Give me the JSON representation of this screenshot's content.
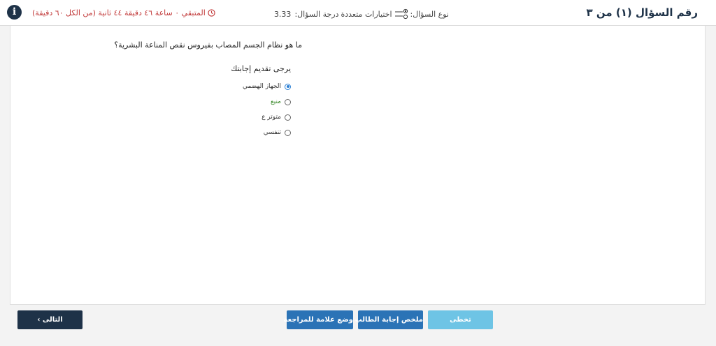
{
  "header": {
    "question_number": "رقم السؤال (١) من ٣",
    "question_type_label": "نوع السؤال:",
    "question_type_value": "اختيارات متعددة",
    "score_label": "درجة السؤال:",
    "score_value": "3.33",
    "timer_text": "المتبقي ٠ ساعة ٤٦ دقيقة ٤٤ ثانية (من الكل ٦٠ دقيقة)",
    "type_icon": "radio-list-icon",
    "timer_icon": "clock-icon",
    "info_icon": "info-icon",
    "info_glyph": "i"
  },
  "question": {
    "text": "ما هو نظام الجسم المصاب بفيروس نقص المناعة البشرية؟",
    "instruction": "يرجى تقديم إجابتك",
    "options": [
      {
        "label": "الجهاز الهضمي",
        "selected": true
      },
      {
        "label": "منيع",
        "selected": false
      },
      {
        "label": "متوتر ع",
        "selected": false
      },
      {
        "label": "تنفسي",
        "selected": false
      }
    ]
  },
  "buttons": {
    "skip": "تخطى",
    "summary": "ملخص إجابة الطالب",
    "mark": "وضع علامة للمراجعة",
    "next": "التالى ›"
  },
  "colors": {
    "primary_dark": "#1e3248",
    "primary": "#2b73b6",
    "skip": "#6ec4e5",
    "timer": "#c23b3b",
    "hint_option": "#3d8b2e",
    "selected_radio": "#2a7fd4"
  }
}
